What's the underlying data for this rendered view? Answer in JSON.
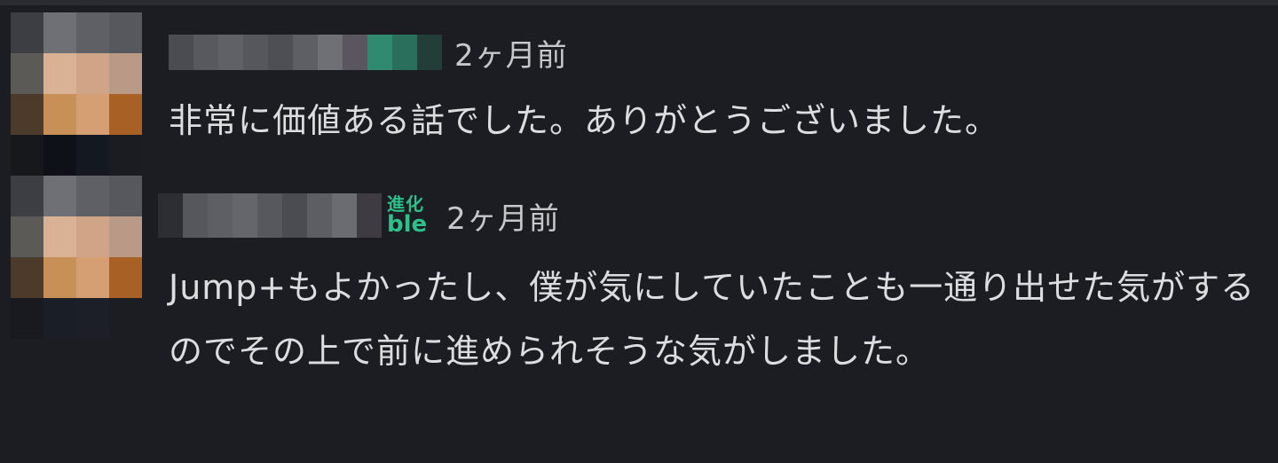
{
  "comments": [
    {
      "time": "2ヶ月前",
      "text": "非常に価値ある話でした。ありがとうございました。"
    },
    {
      "badge_line1": "進化",
      "badge_line2": "ble",
      "time": "2ヶ月前",
      "text": "Jump+もよかったし、僕が気にしていたことも一通り出せた気がするのでその上で前に進められそうな気がしました。"
    }
  ],
  "colors": {
    "background": "#1b1d22",
    "text": "#dcdde0",
    "timestamp": "#c6c7ca",
    "badge": "#2fbf8a"
  }
}
